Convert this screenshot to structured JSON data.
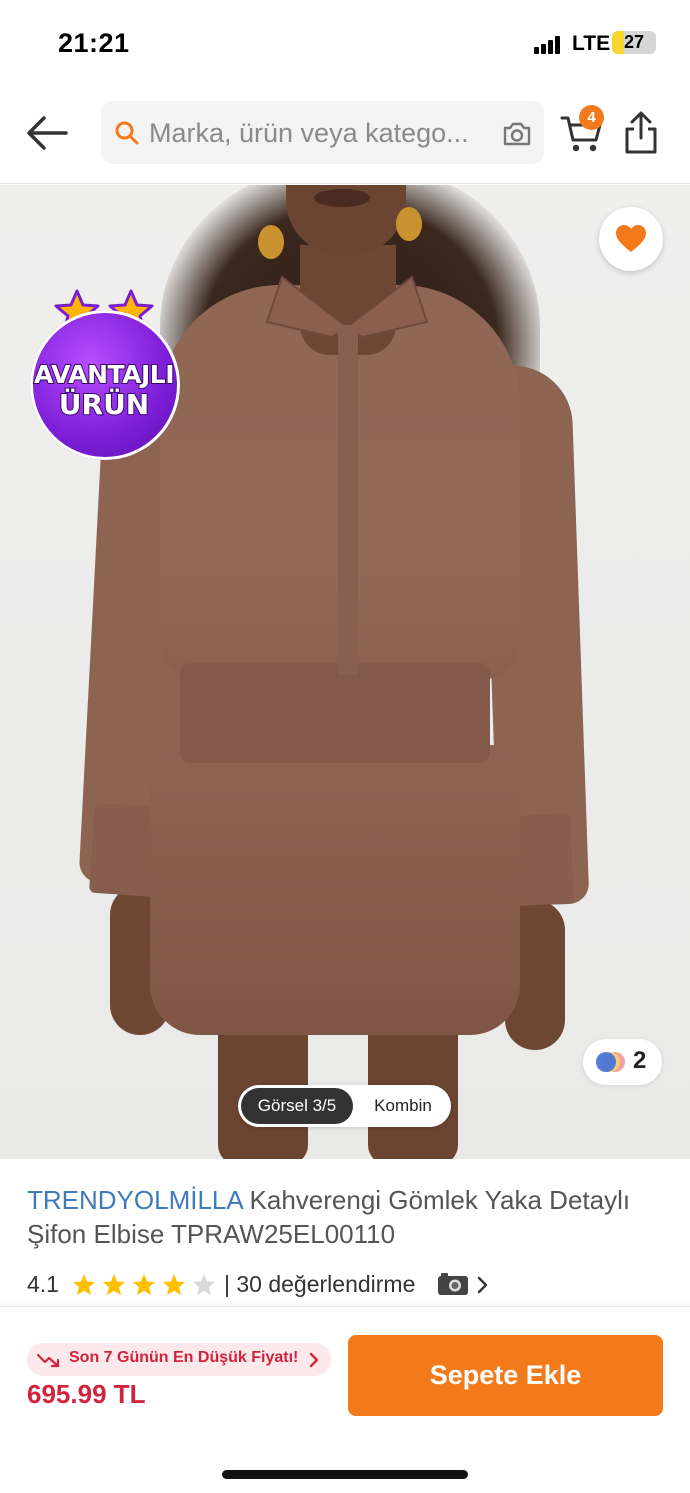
{
  "status_bar": {
    "time": "21:21",
    "network": "LTE",
    "battery_level": "27",
    "battery_fraction": 0.27,
    "battery_color": "#f7d631"
  },
  "header": {
    "back_icon": "arrow-left-icon",
    "search_placeholder": "Marka, ürün veya katego...",
    "search_icon": "search-icon",
    "camera_icon": "camera-icon",
    "cart_icon": "cart-icon",
    "cart_count": "4",
    "share_icon": "share-icon"
  },
  "gallery": {
    "favorite_icon": "heart-icon",
    "badge_line1": "AVANTAJLI",
    "badge_line2": "ÜRÜN",
    "variants_count": "2",
    "view_tabs": {
      "active": "Görsel 3/5",
      "other": "Kombin"
    }
  },
  "product": {
    "brand": "TRENDYOLMİLLA",
    "name": "Kahverengi Gömlek Yaka Detaylı Şifon Elbise TPRAW25EL00110",
    "rating": "4.1",
    "rating_stars": 4,
    "rating_count_text": "| 30 değerlendirme"
  },
  "bottom_bar": {
    "lowest_price_label": "Son 7 Günün En Düşük Fiyatı!",
    "price": "695.99 TL",
    "add_to_cart_label": "Sepete Ekle"
  },
  "colors": {
    "brand_orange": "#f27a1a",
    "price_red": "#d0243d",
    "brand_blue": "#3d7bbd"
  }
}
